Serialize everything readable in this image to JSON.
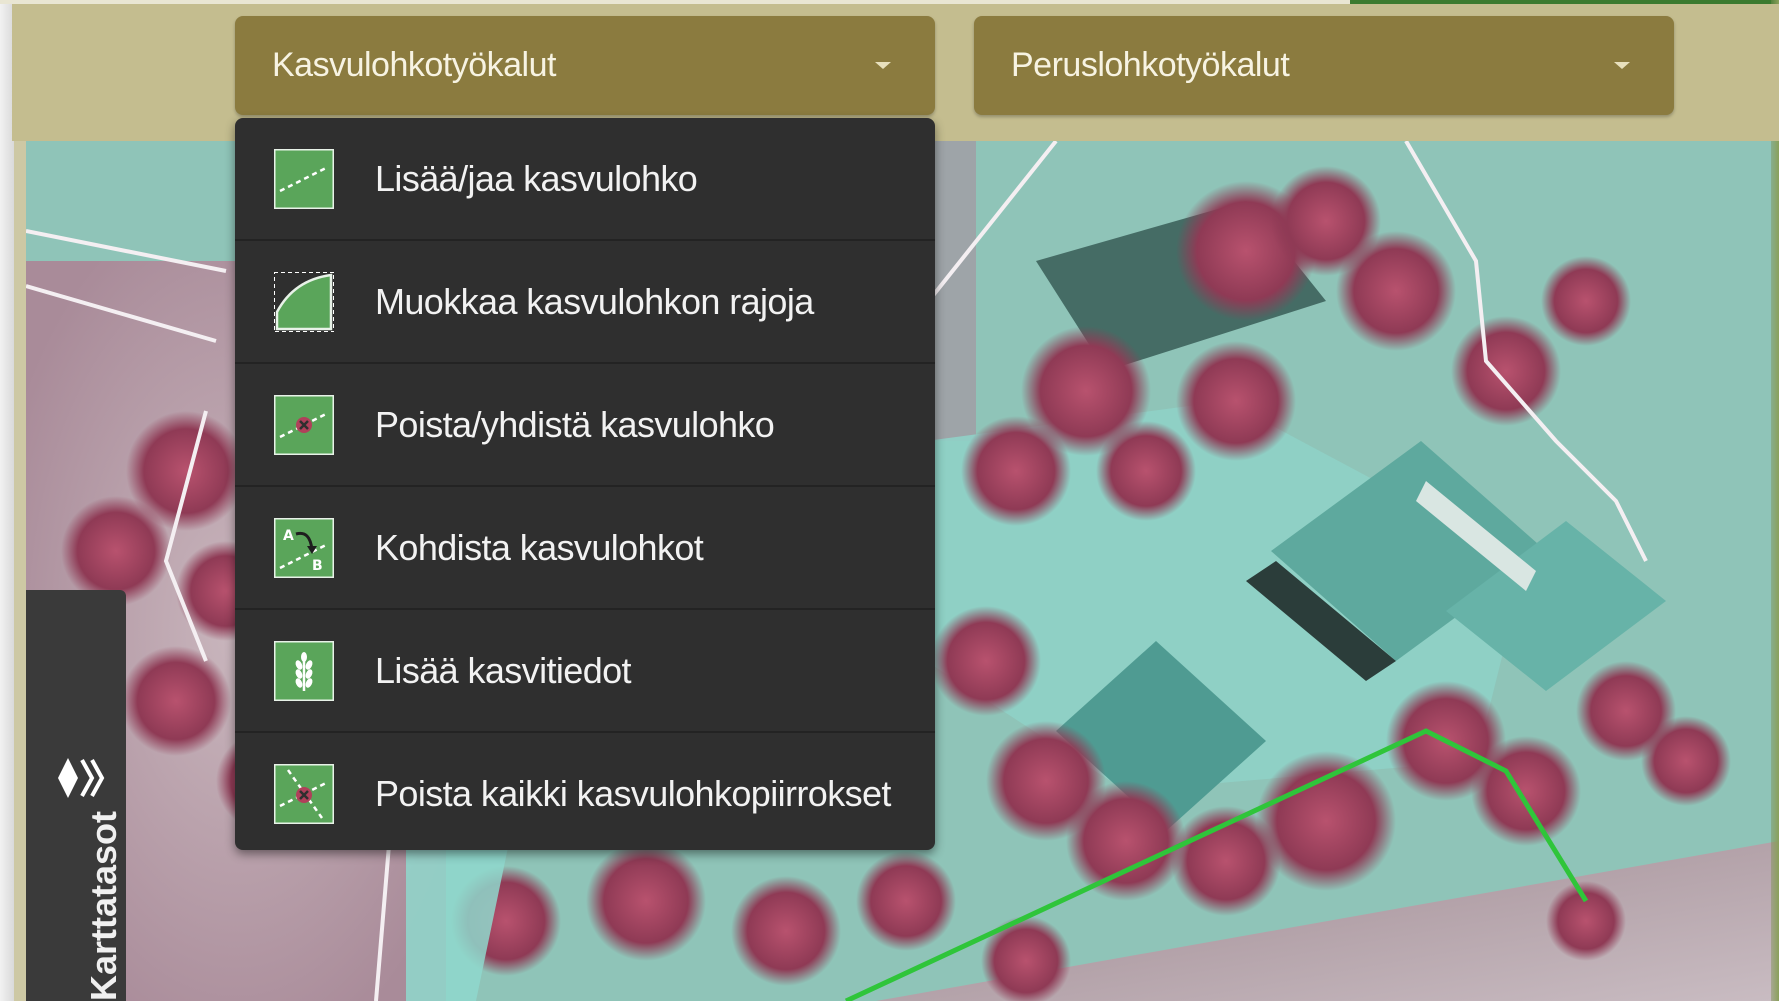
{
  "toolbar": {
    "dropdowns": [
      {
        "label": "Kasvulohkotyökalut",
        "expanded": true
      },
      {
        "label": "Peruslohkotyökalut",
        "expanded": false
      }
    ]
  },
  "menu": {
    "items": [
      {
        "label": "Lisää/jaa kasvulohko",
        "icon": "add-split-parcel-icon"
      },
      {
        "label": "Muokkaa kasvulohkon rajoja",
        "icon": "edit-boundaries-icon"
      },
      {
        "label": "Poista/yhdistä kasvulohko",
        "icon": "delete-merge-parcel-icon"
      },
      {
        "label": "Kohdista kasvulohkot",
        "icon": "align-parcels-icon"
      },
      {
        "label": "Lisää kasvitiedot",
        "icon": "crop-info-icon"
      },
      {
        "label": "Poista kaikki kasvulohkopiirrokset",
        "icon": "delete-all-drawings-icon"
      }
    ]
  },
  "side_panel": {
    "label": "Karttatasot",
    "icon": "layers-icon"
  },
  "colors": {
    "toolbar_bg": "#c4bd8f",
    "dropdown_bg": "#8b7b3f",
    "menu_bg": "#2f2f2f",
    "icon_green": "#5aa55a",
    "boundary_green": "#2fc53a"
  }
}
